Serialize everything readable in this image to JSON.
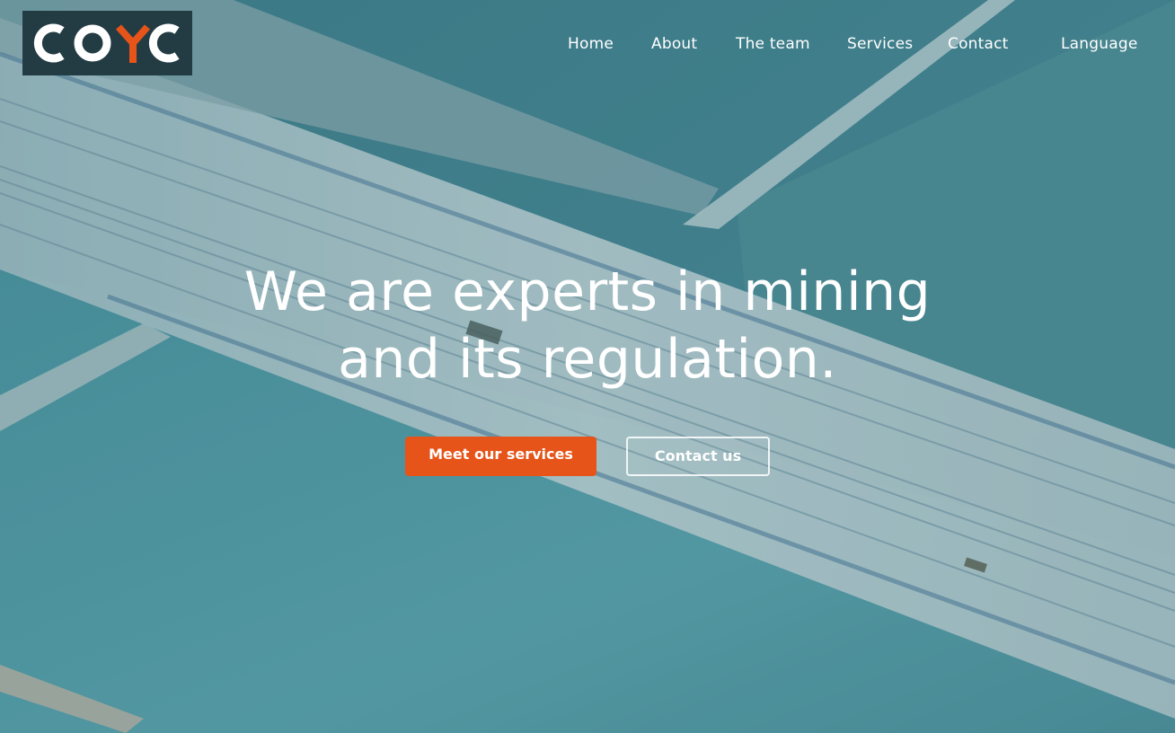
{
  "brand": {
    "logo_text": "COYC",
    "logo_colors": {
      "background": "#233c44",
      "letters": "#ffffff",
      "accent": "#e65419"
    }
  },
  "nav": {
    "items": [
      {
        "label": "Home"
      },
      {
        "label": "About"
      },
      {
        "label": "The team"
      },
      {
        "label": "Services"
      },
      {
        "label": "Contact"
      },
      {
        "label": "Language"
      }
    ]
  },
  "hero": {
    "headline_line1": "We are experts in mining",
    "headline_line2": "and its regulation.",
    "background_description_icon": "aerial-salt-flats-photo",
    "primary_button_label": "Meet our services",
    "secondary_button_label": "Contact us"
  },
  "colors": {
    "accent": "#e65419",
    "text": "#ffffff",
    "overlay_teal": "#4d8e98"
  }
}
